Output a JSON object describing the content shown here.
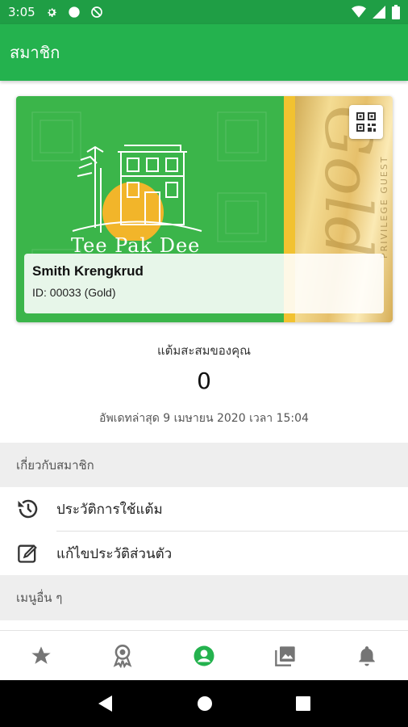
{
  "status_bar": {
    "time": "3:05",
    "left_icons": [
      "gear-icon",
      "circle-icon",
      "no-sync-icon"
    ],
    "right_icons": [
      "wifi-icon",
      "signal-icon",
      "battery-icon"
    ]
  },
  "app_bar": {
    "title": "สมาชิก"
  },
  "card": {
    "brand": "Tee Pak Dee",
    "member_name": "Smith Krengkrud",
    "member_id": "ID: 00033 (Gold)",
    "qr_icon": "qr-code-icon",
    "gold_script": "Gold",
    "gold_vertical_text": "PRIVILEGE GUEST",
    "colors": {
      "green": "#3bb54a",
      "gold": "#e6c06b",
      "stripe": "#f2c230"
    }
  },
  "points": {
    "label": "แต้มสะสมของคุณ",
    "value": "0",
    "updated": "อัพเดทล่าสุด 9 เมษายน 2020 เวลา 15:04"
  },
  "sections": {
    "member": {
      "title": "เกี่ยวกับสมาชิก"
    },
    "other": {
      "title": "เมนูอื่น ๆ"
    }
  },
  "menu": [
    {
      "label": "ประวัติการใช้แต้ม",
      "icon": "history-icon"
    },
    {
      "label": "แก้ไขประวัติส่วนตัว",
      "icon": "edit-icon"
    }
  ],
  "bottom_nav": [
    {
      "icon": "star-icon",
      "active": false
    },
    {
      "icon": "award-icon",
      "active": false
    },
    {
      "icon": "account-icon",
      "active": true
    },
    {
      "icon": "gallery-icon",
      "active": false
    },
    {
      "icon": "bell-icon",
      "active": false
    }
  ],
  "theme": {
    "primary": "#24b24e",
    "primary_dark": "#1f9e45",
    "icon_inactive": "#757575"
  }
}
